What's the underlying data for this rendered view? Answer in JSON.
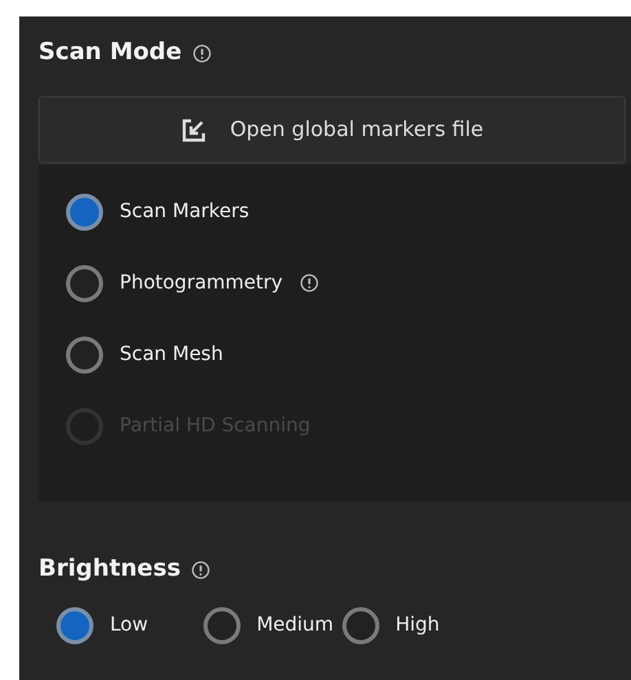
{
  "scan_mode": {
    "title": "Scan Mode",
    "has_notice": true,
    "open_button": {
      "label": "Open global markers file"
    },
    "options": [
      {
        "label": "Scan Markers",
        "selected": true,
        "disabled": false,
        "has_notice": false
      },
      {
        "label": "Photogrammetry",
        "selected": false,
        "disabled": false,
        "has_notice": true
      },
      {
        "label": "Scan Mesh",
        "selected": false,
        "disabled": false,
        "has_notice": false
      },
      {
        "label": "Partial HD Scanning",
        "selected": false,
        "disabled": true,
        "has_notice": false
      }
    ]
  },
  "brightness": {
    "title": "Brightness",
    "has_notice": true,
    "options": [
      {
        "label": "Low",
        "selected": true
      },
      {
        "label": "Medium",
        "selected": false
      },
      {
        "label": "High",
        "selected": false
      }
    ]
  }
}
